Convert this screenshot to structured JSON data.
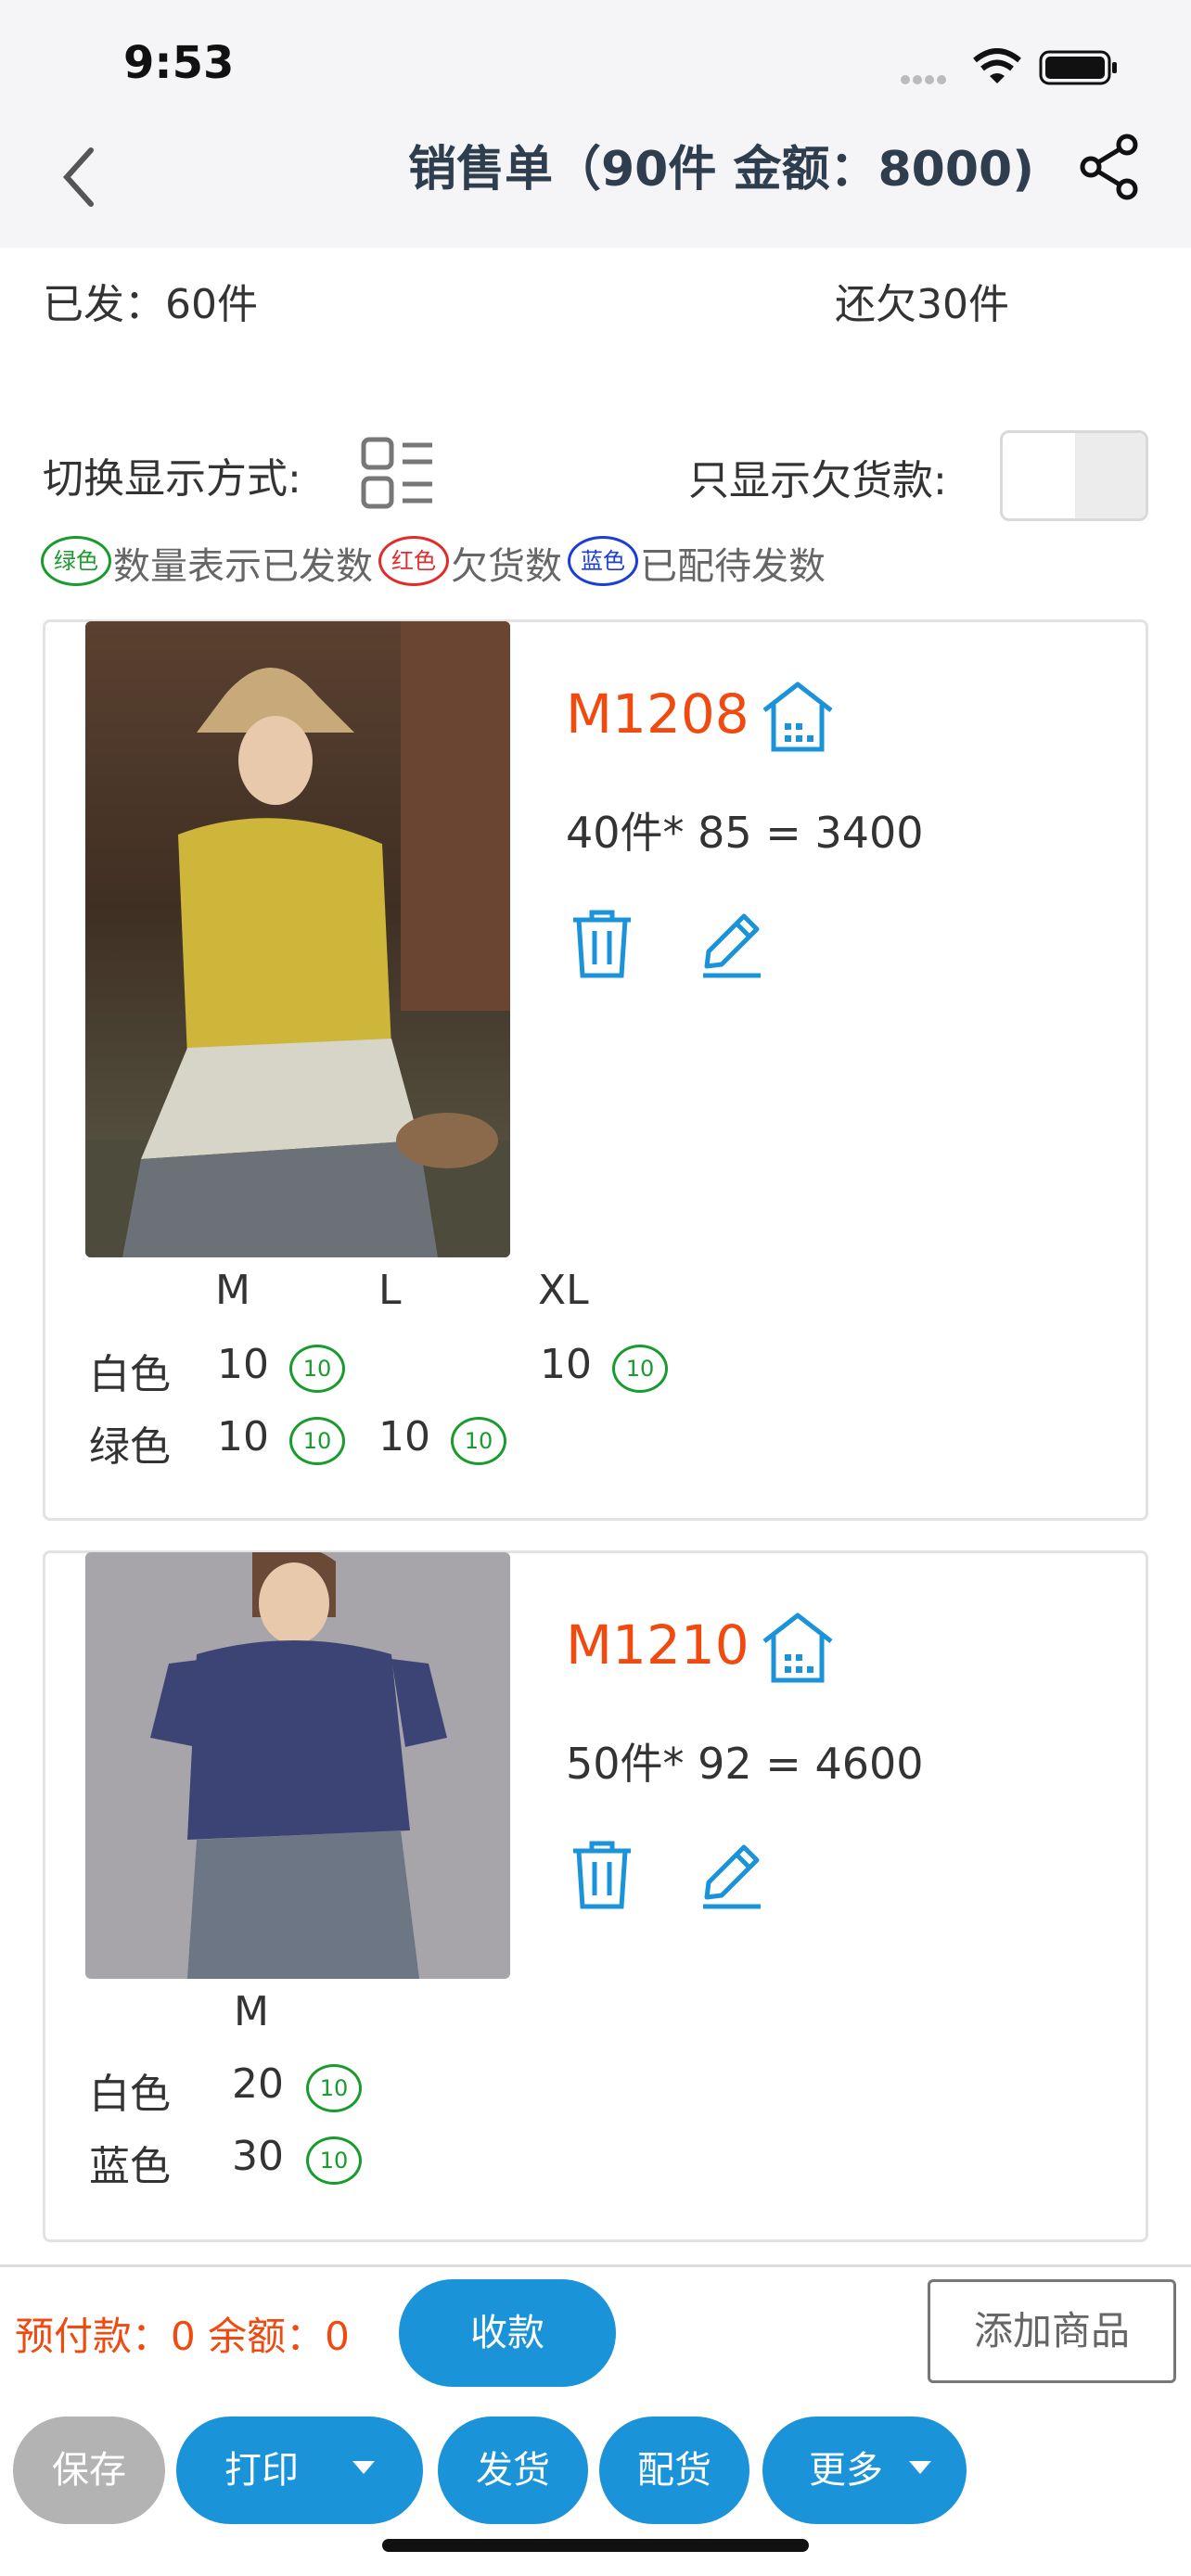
{
  "status_bar": {
    "time": "9:53"
  },
  "header": {
    "title": "销售单（90件 金额：8000)"
  },
  "summary": {
    "shipped": "已发：60件",
    "owed": "还欠30件"
  },
  "options": {
    "switch_label": "切换显示方式:",
    "owed_only_label": "只显示欠货款:",
    "owed_only_on": false
  },
  "legend": {
    "green_tag": "绿色",
    "green_text": "数量表示已发数",
    "red_tag": "红色",
    "red_text": "欠货数",
    "blue_tag": "蓝色",
    "blue_text": "已配待发数",
    "colors": {
      "green": "#1a9b2d",
      "red": "#e22c2c",
      "blue": "#1b3ddb"
    }
  },
  "products": [
    {
      "code": "M1208",
      "calc": "40件* 85 = 3400",
      "sizes": [
        "M",
        "L",
        "XL"
      ],
      "rows": [
        {
          "color": "白色",
          "cells": [
            {
              "qty": "10",
              "sent": "10"
            },
            {
              "qty": "",
              "sent": ""
            },
            {
              "qty": "10",
              "sent": "10"
            }
          ]
        },
        {
          "color": "绿色",
          "cells": [
            {
              "qty": "10",
              "sent": "10"
            },
            {
              "qty": "10",
              "sent": "10"
            },
            {
              "qty": "",
              "sent": ""
            }
          ]
        }
      ]
    },
    {
      "code": "M1210",
      "calc": "50件* 92 = 4600",
      "sizes": [
        "M"
      ],
      "rows": [
        {
          "color": "白色",
          "cells": [
            {
              "qty": "20",
              "sent": "10"
            }
          ]
        },
        {
          "color": "蓝色",
          "cells": [
            {
              "qty": "30",
              "sent": "10"
            }
          ]
        }
      ]
    }
  ],
  "footer": {
    "prepay": "预付款：0 余额：0",
    "collect_btn": "收款",
    "add_btn": "添加商品",
    "save_btn": "保存",
    "print_btn": "打印",
    "ship_btn": "发货",
    "allocate_btn": "配货",
    "more_btn": "更多"
  },
  "theme": {
    "accent": "#1b93d8",
    "code_color": "#f04a10"
  }
}
